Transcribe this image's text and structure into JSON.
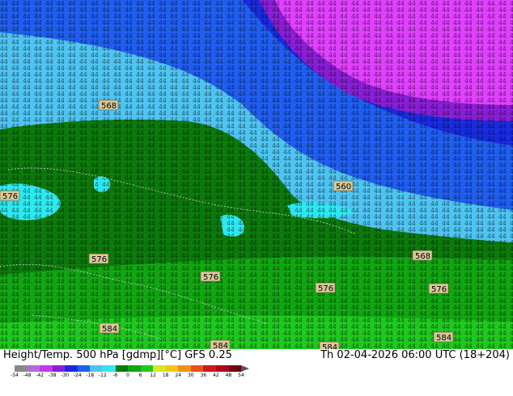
{
  "map": {
    "field_colors": {
      "deep_purple": "#e040ff",
      "purple": "#8a1ed6",
      "dark_blue": "#1a2ae0",
      "blue": "#1f5ef0",
      "light_blue": "#4ec4f2",
      "cyan": "#2ee8f0",
      "dark_green": "#0b7a0b",
      "green": "#11a611",
      "bright_green": "#1fc81f"
    },
    "contour_labels": [
      "568",
      "576",
      "560",
      "576",
      "568",
      "576",
      "576",
      "576",
      "584",
      "584",
      "584",
      "584"
    ]
  },
  "footer": {
    "title_left": "Height/Temp. 500 hPa [gdmp][°C] GFS 0.25",
    "title_right": "Th 02-04-2026 06:00 UTC (18+204)",
    "colorbar": {
      "ticks": [
        "-54",
        "-48",
        "-42",
        "-38",
        "-30",
        "-24",
        "-18",
        "-12",
        "-6",
        "0",
        "6",
        "12",
        "18",
        "24",
        "30",
        "36",
        "42",
        "48",
        "54"
      ],
      "colors": [
        "#888888",
        "#b06cd8",
        "#c438e8",
        "#8a1ed6",
        "#1a2ae0",
        "#1f5ef0",
        "#4ec4f2",
        "#2ee8f0",
        "#0b7a0b",
        "#11a611",
        "#1fc81f",
        "#d8e820",
        "#f0c818",
        "#f09018",
        "#e85018",
        "#d01818",
        "#a80818",
        "#700010"
      ],
      "arrow_color": "#555555"
    }
  }
}
